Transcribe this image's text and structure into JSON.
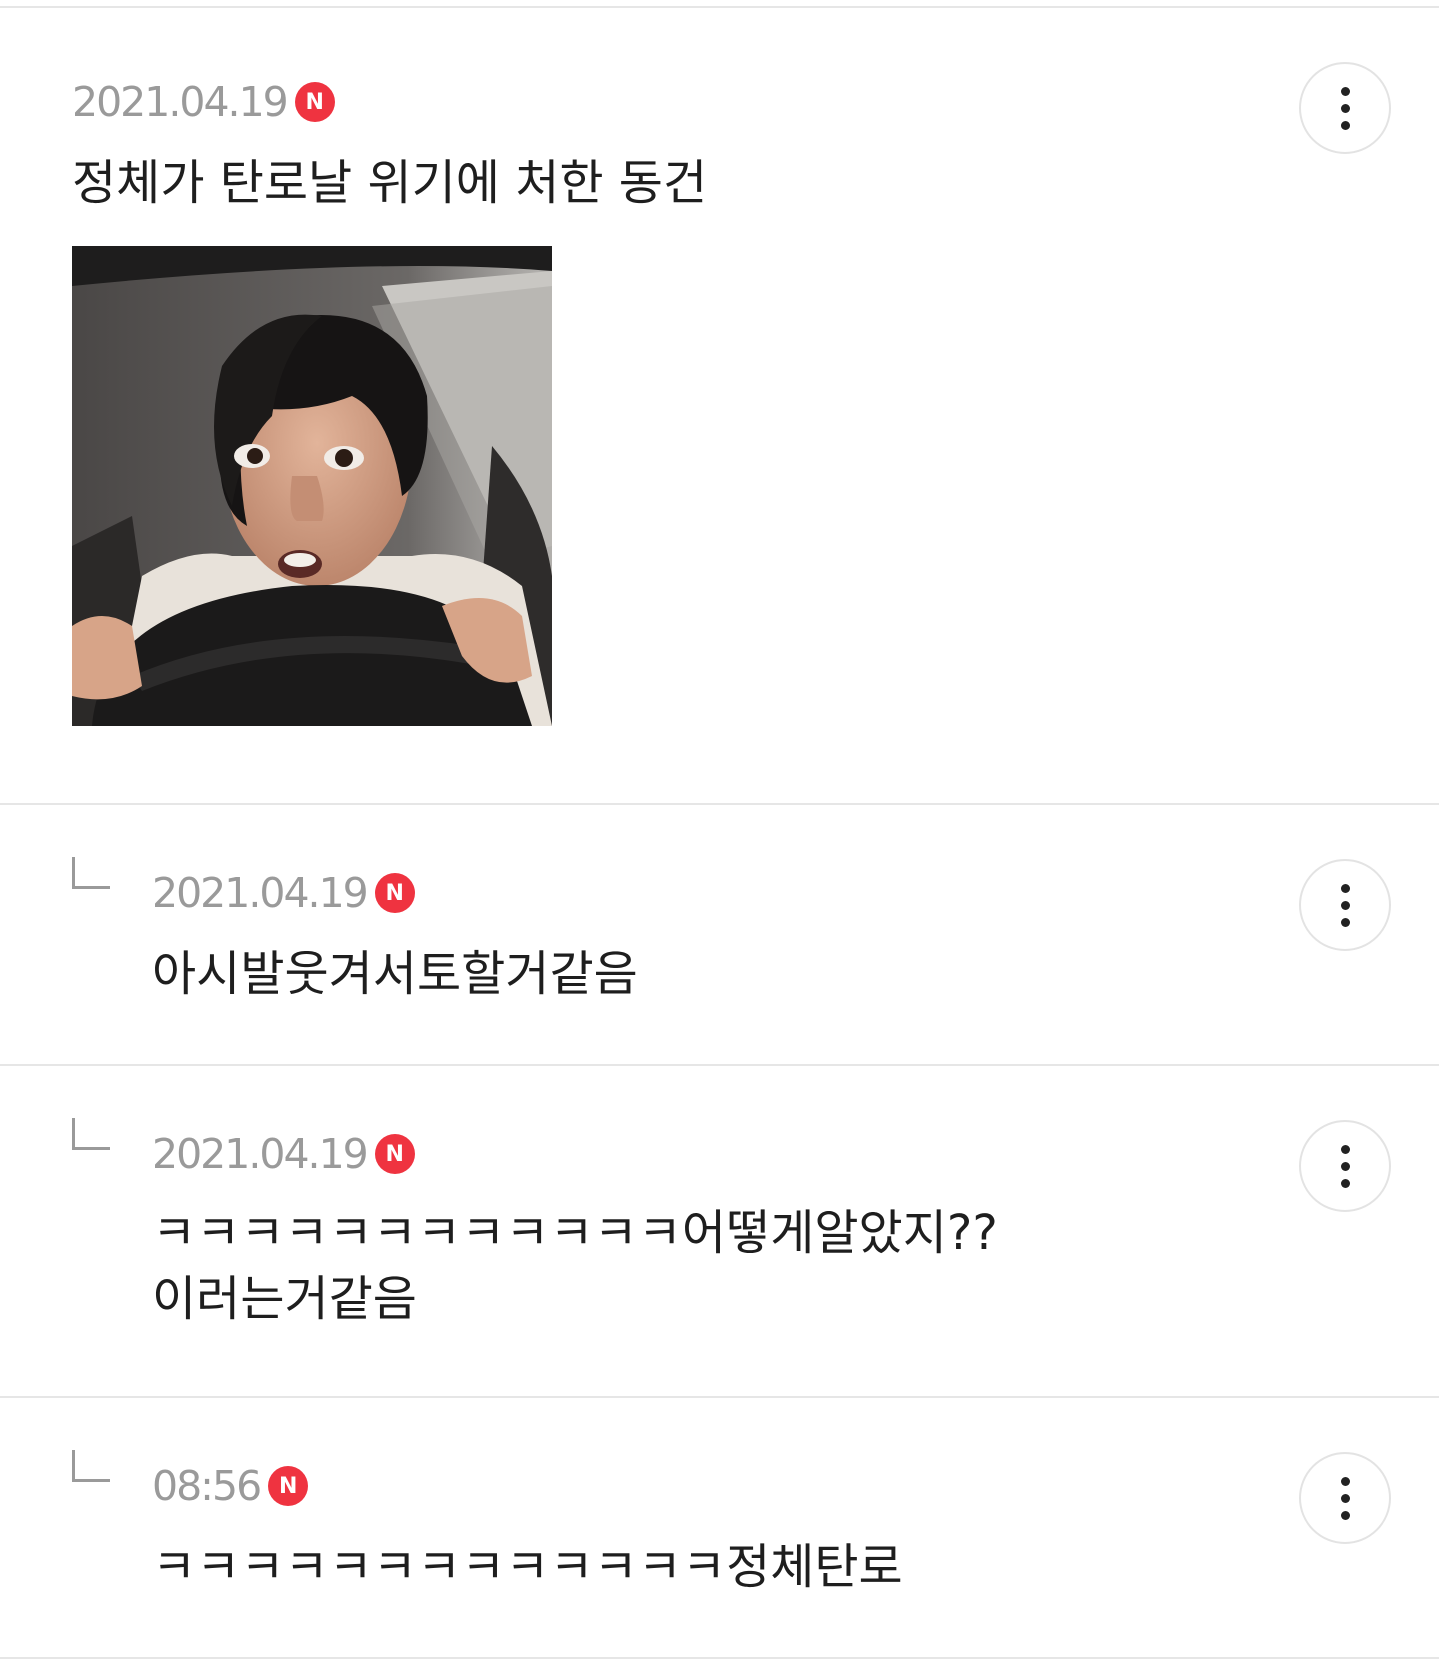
{
  "post": {
    "date": "2021.04.19",
    "new_badge": "N",
    "title": "정체가 탄로날 위기에 처한 동건",
    "image_alt": "",
    "more_icon": "more-vertical-icon"
  },
  "replies": [
    {
      "date": "2021.04.19",
      "new_badge": "N",
      "text": "아시발웃겨서토할거같음"
    },
    {
      "date": "2021.04.19",
      "new_badge": "N",
      "text": "ㅋㅋㅋㅋㅋㅋㅋㅋㅋㅋㅋㅋ어떻게알았지??\n이러는거같음"
    },
    {
      "date": "08:56",
      "new_badge": "N",
      "text": "ㅋㅋㅋㅋㅋㅋㅋㅋㅋㅋㅋㅋㅋ정체탄로"
    }
  ],
  "colors": {
    "badge": "#ef3340",
    "divider": "#e6e6e6",
    "date": "#9a9a9a"
  }
}
